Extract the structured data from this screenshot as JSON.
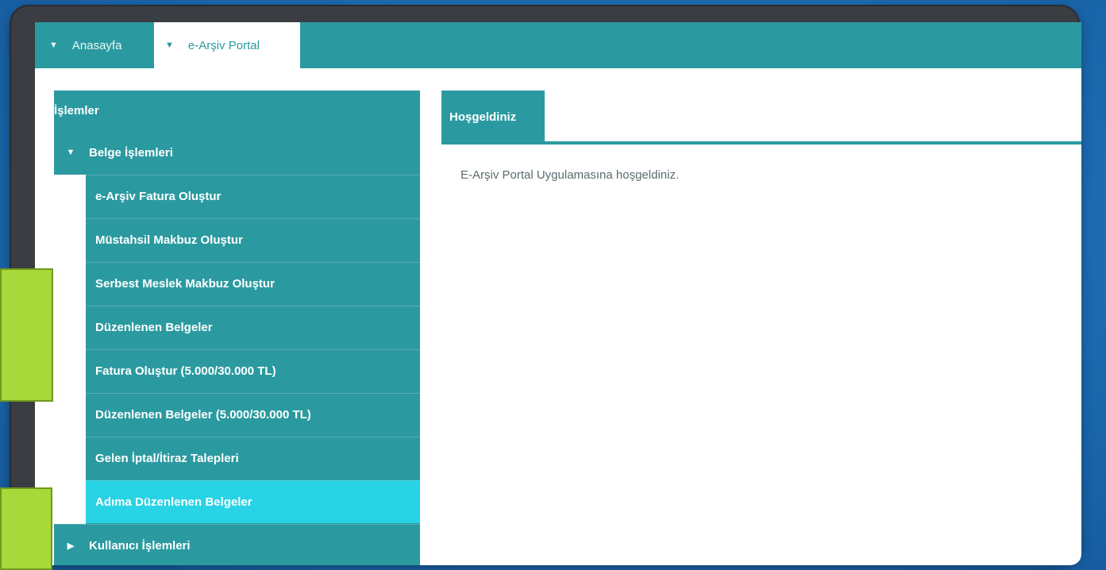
{
  "tabs": {
    "home_label": "Anasayfa",
    "portal_label": "e-Arşiv Portal"
  },
  "sidebar": {
    "header": "İşlemler",
    "group_label": "Belge İşlemleri",
    "items": [
      {
        "label": "e-Arşiv Fatura Oluştur"
      },
      {
        "label": "Müstahsil Makbuz Oluştur"
      },
      {
        "label": "Serbest Meslek Makbuz Oluştur"
      },
      {
        "label": "Düzenlenen Belgeler"
      },
      {
        "label": "Fatura Oluştur (5.000/30.000 TL)"
      },
      {
        "label": "Düzenlenen Belgeler (5.000/30.000 TL)"
      },
      {
        "label": "Gelen İptal/İtiraz Talepleri"
      },
      {
        "label": "Adıma Düzenlenen Belgeler"
      }
    ],
    "users_label": "Kullanıcı İşlemleri"
  },
  "content": {
    "tab_label": "Hoşgeldiniz",
    "welcome_text": "E-Arşiv Portal Uygulamasına hoşgeldiniz."
  },
  "colors": {
    "teal": "#2b9aa0",
    "active": "#27d3e4",
    "accent_green": "#a8d83a"
  }
}
